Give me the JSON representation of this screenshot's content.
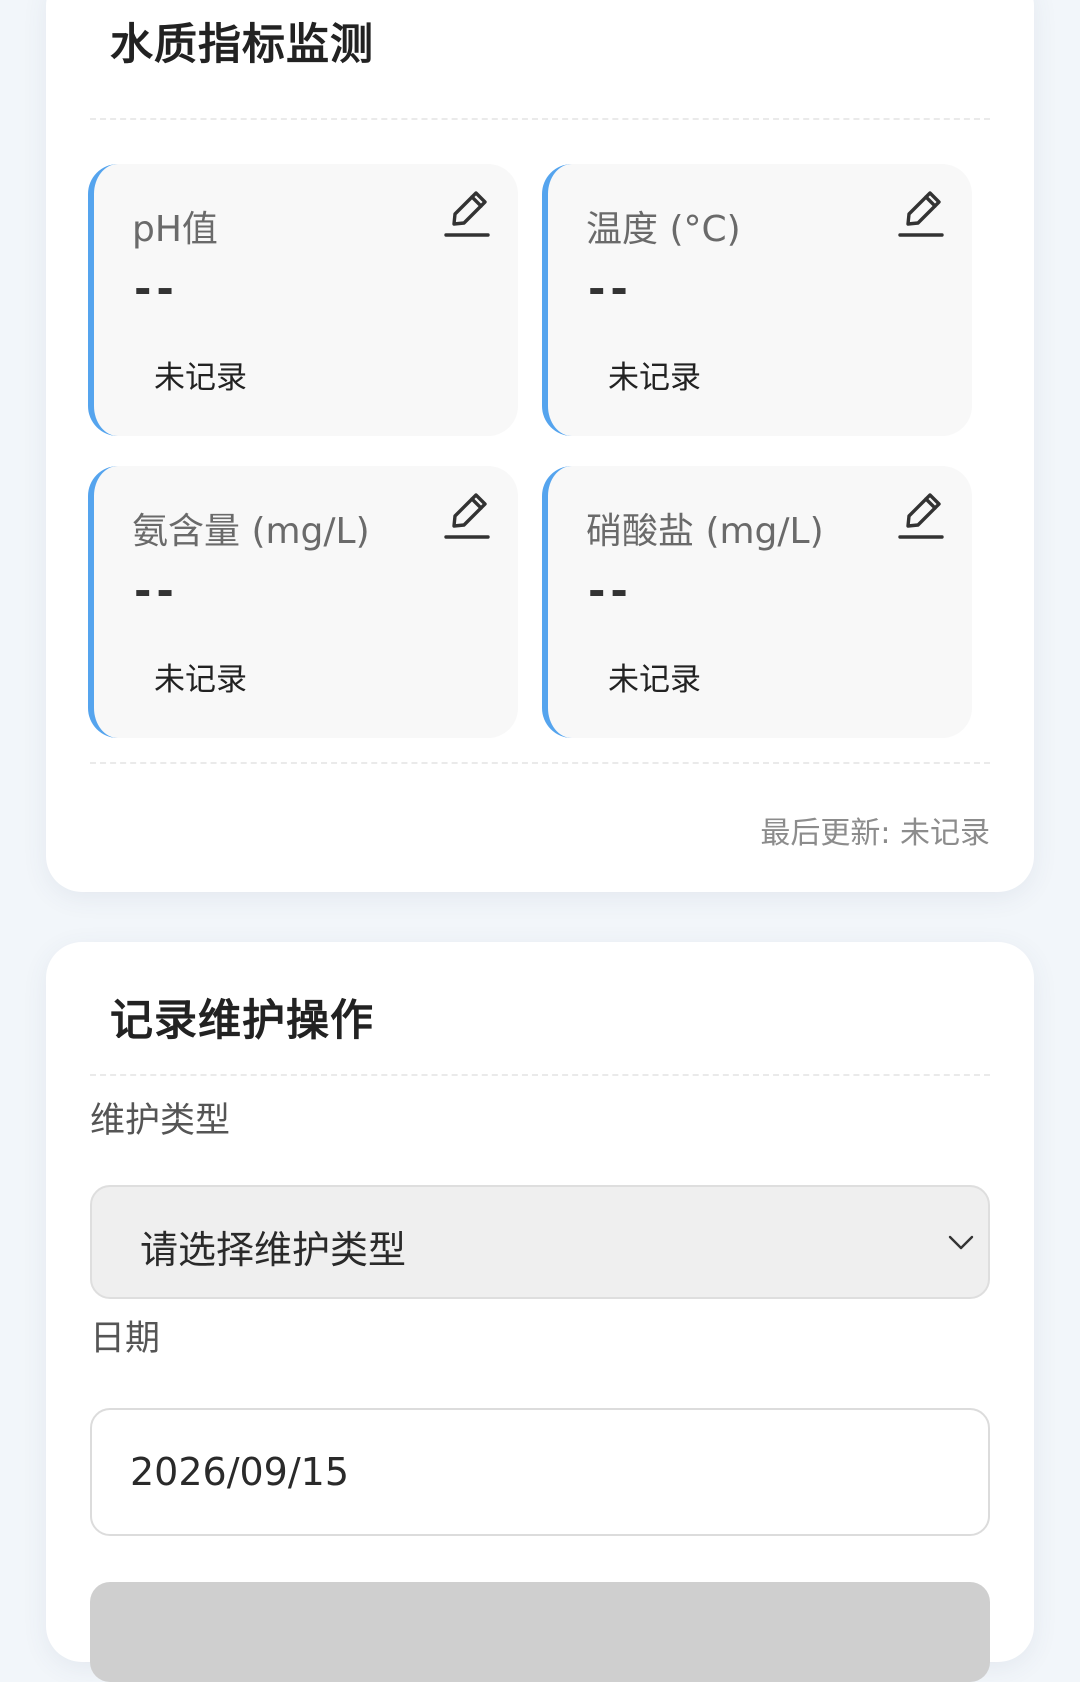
{
  "water_quality": {
    "title": "水质指标监测",
    "metrics": [
      {
        "label": "pH值",
        "value": "--",
        "status": "未记录"
      },
      {
        "label": "温度 (°C)",
        "value": "--",
        "status": "未记录"
      },
      {
        "label": "氨含量 (mg/L)",
        "value": "--",
        "status": "未记录"
      },
      {
        "label": "硝酸盐 (mg/L)",
        "value": "--",
        "status": "未记录"
      }
    ],
    "last_update": "最后更新: 未记录"
  },
  "maintenance": {
    "title": "记录维护操作",
    "type_label": "维护类型",
    "type_placeholder": "请选择维护类型",
    "date_label": "日期",
    "date_value": "2026/09/15"
  },
  "icons": {
    "edit": "pencil-edit-icon",
    "dropdown": "chevron-down-icon"
  },
  "colors": {
    "accent": "#55a4ee",
    "background": "#f2f6fa",
    "card": "#ffffff",
    "metric_card": "#f8f8f8"
  }
}
